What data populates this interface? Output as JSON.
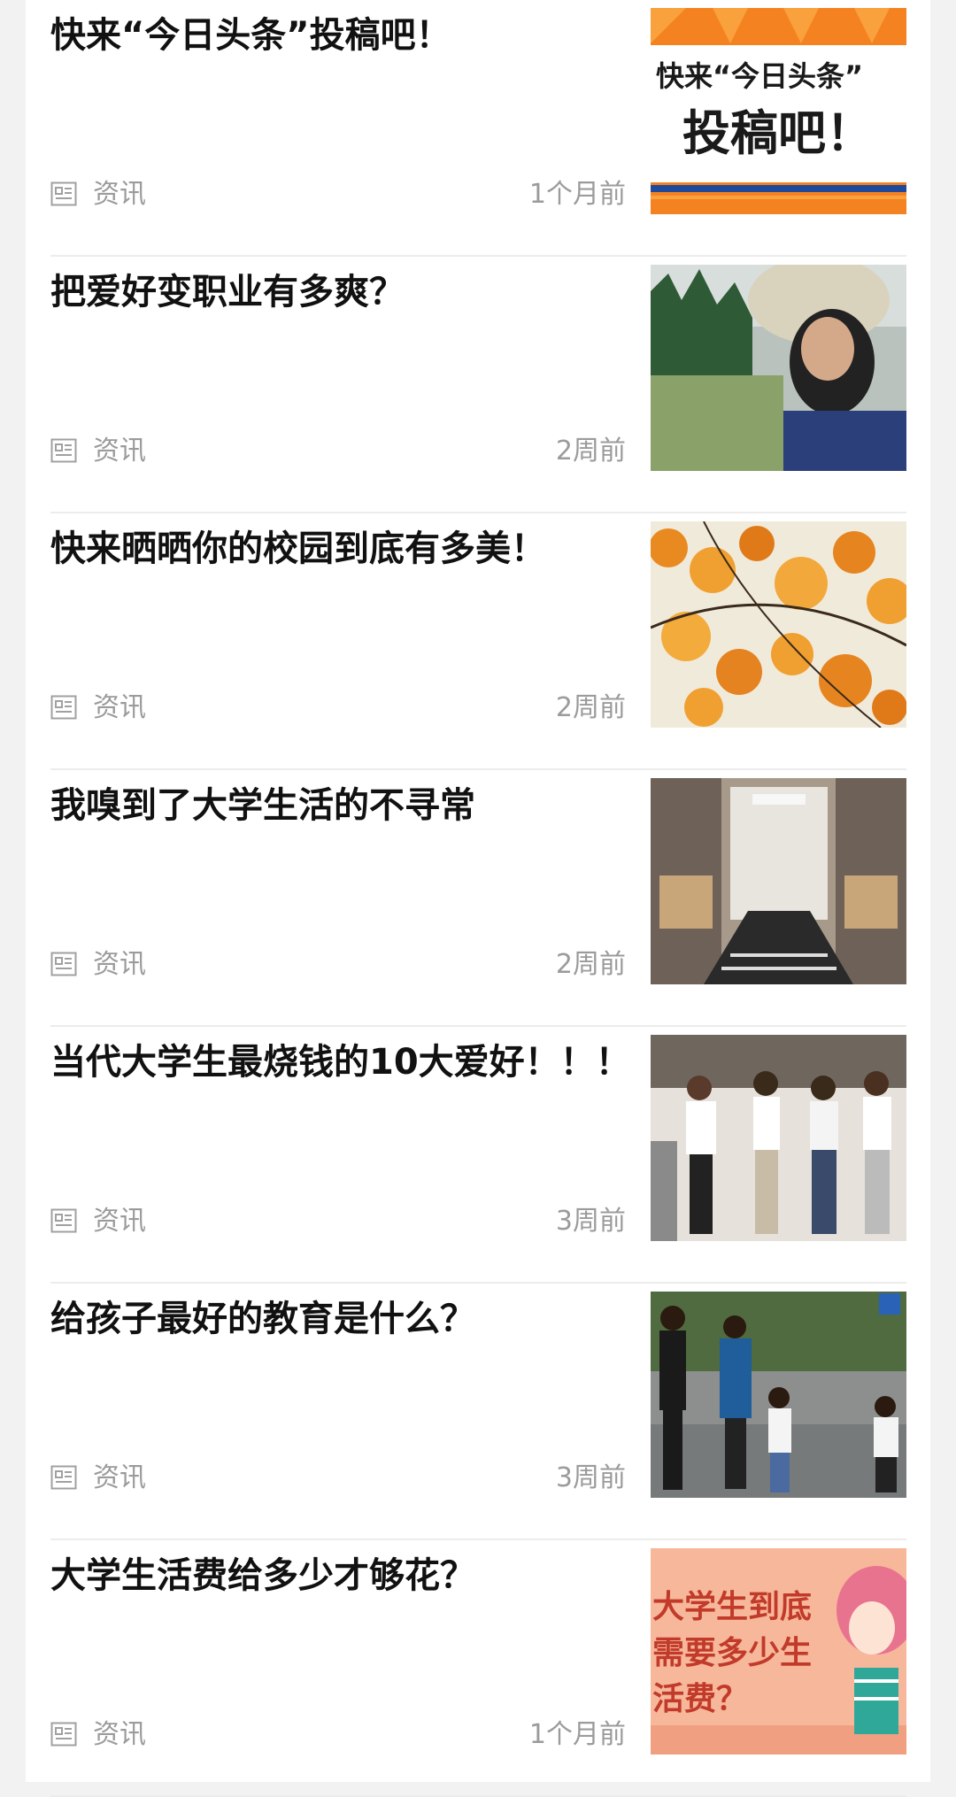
{
  "feed": {
    "items": [
      {
        "title": "快来“今日头条”投稿吧！",
        "category": "资讯",
        "time": "1个月前",
        "image_overlay": [
          "快来“今日头条”",
          "投稿吧！"
        ]
      },
      {
        "title": "把爱好变职业有多爽？",
        "category": "资讯",
        "time": "2周前"
      },
      {
        "title": "快来晒晒你的校园到底有多美！",
        "category": "资讯",
        "time": "2周前"
      },
      {
        "title": "我嗅到了大学生活的不寻常",
        "category": "资讯",
        "time": "2周前"
      },
      {
        "title": "当代大学生最烧钱的10大爱好！！！",
        "category": "资讯",
        "time": "3周前"
      },
      {
        "title": "给孩子最好的教育是什么？",
        "category": "资讯",
        "time": "3周前"
      },
      {
        "title": "大学生活费给多少才够花？",
        "category": "资讯",
        "time": "1个月前",
        "image_overlay": [
          "大学生到底",
          "需要多少生",
          "活费？"
        ]
      }
    ]
  },
  "colors": {
    "title": "#111111",
    "meta": "#9b9b9b",
    "divider": "#ececec",
    "banner_orange": "#f58220",
    "banner_blue": "#1f4a9c"
  },
  "icons": {
    "item_type": "news-article-icon"
  }
}
